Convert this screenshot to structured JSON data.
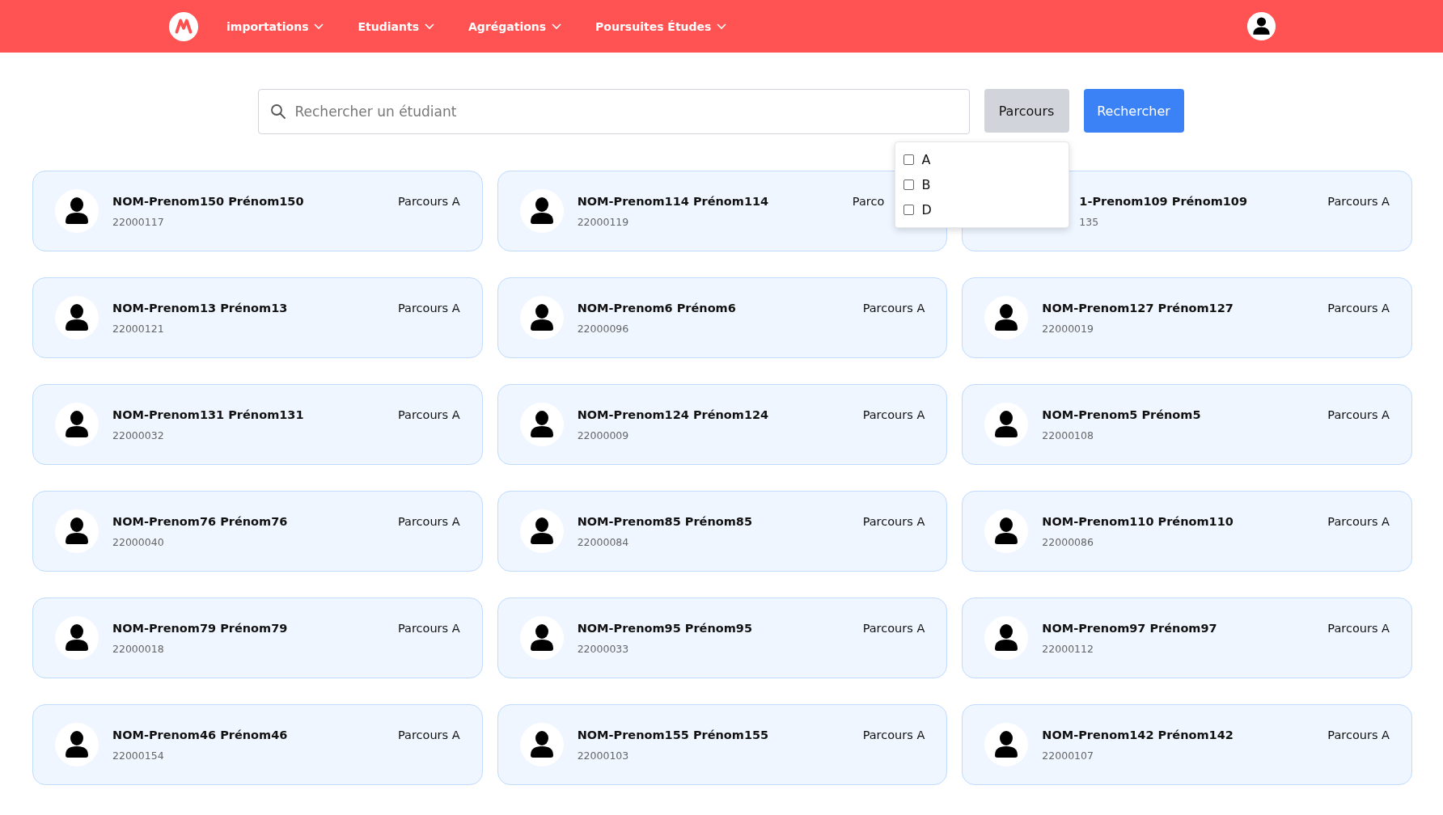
{
  "nav": [
    {
      "label": "importations"
    },
    {
      "label": "Etudiants"
    },
    {
      "label": "Agrégations"
    },
    {
      "label": "Poursuites Études"
    }
  ],
  "search": {
    "placeholder": "Rechercher un étudiant",
    "filter_button": "Parcours",
    "submit_button": "Rechercher"
  },
  "filter_menu": [
    {
      "label": "A",
      "checked": false
    },
    {
      "label": "B",
      "checked": false
    },
    {
      "label": "D",
      "checked": false
    }
  ],
  "students": [
    {
      "name": "NOM-Prenom150 Prénom150",
      "id": "22000117",
      "parcours": "Parcours A",
      "kind": "normal"
    },
    {
      "name": "NOM-Prenom114 Prénom114",
      "id": "22000119",
      "parcours": "Parco",
      "kind": "covered_right"
    },
    {
      "name": "1-Prenom109 Prénom109",
      "id": "135",
      "parcours": "Parcours A",
      "kind": "covered_left"
    },
    {
      "name": "NOM-Prenom13 Prénom13",
      "id": "22000121",
      "parcours": "Parcours A",
      "kind": "normal"
    },
    {
      "name": "NOM-Prenom6 Prénom6",
      "id": "22000096",
      "parcours": "Parcours A",
      "kind": "normal"
    },
    {
      "name": "NOM-Prenom127 Prénom127",
      "id": "22000019",
      "parcours": "Parcours A",
      "kind": "normal"
    },
    {
      "name": "NOM-Prenom131 Prénom131",
      "id": "22000032",
      "parcours": "Parcours A",
      "kind": "normal"
    },
    {
      "name": "NOM-Prenom124 Prénom124",
      "id": "22000009",
      "parcours": "Parcours A",
      "kind": "normal"
    },
    {
      "name": "NOM-Prenom5 Prénom5",
      "id": "22000108",
      "parcours": "Parcours A",
      "kind": "normal"
    },
    {
      "name": "NOM-Prenom76 Prénom76",
      "id": "22000040",
      "parcours": "Parcours A",
      "kind": "normal"
    },
    {
      "name": "NOM-Prenom85 Prénom85",
      "id": "22000084",
      "parcours": "Parcours A",
      "kind": "normal"
    },
    {
      "name": "NOM-Prenom110 Prénom110",
      "id": "22000086",
      "parcours": "Parcours A",
      "kind": "normal"
    },
    {
      "name": "NOM-Prenom79 Prénom79",
      "id": "22000018",
      "parcours": "Parcours A",
      "kind": "normal"
    },
    {
      "name": "NOM-Prenom95 Prénom95",
      "id": "22000033",
      "parcours": "Parcours A",
      "kind": "normal"
    },
    {
      "name": "NOM-Prenom97 Prénom97",
      "id": "22000112",
      "parcours": "Parcours A",
      "kind": "normal"
    },
    {
      "name": "NOM-Prenom46 Prénom46",
      "id": "22000154",
      "parcours": "Parcours A",
      "kind": "normal"
    },
    {
      "name": "NOM-Prenom155 Prénom155",
      "id": "22000103",
      "parcours": "Parcours A",
      "kind": "normal"
    },
    {
      "name": "NOM-Prenom142 Prénom142",
      "id": "22000107",
      "parcours": "Parcours A",
      "kind": "normal"
    }
  ]
}
